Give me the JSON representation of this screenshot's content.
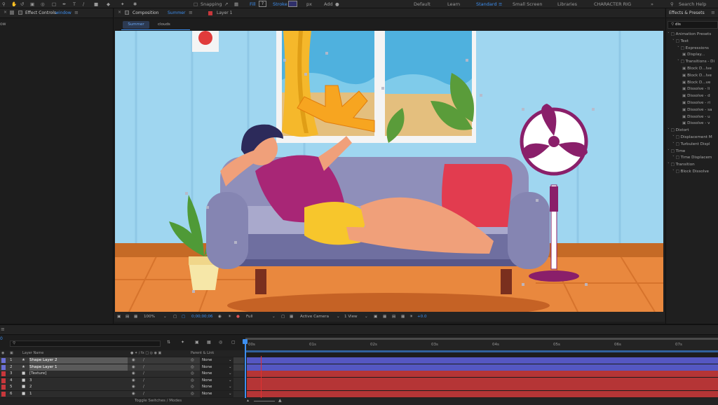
{
  "toolbar": {
    "snapping": "Snapping",
    "fill": "Fill",
    "stroke": "Stroke",
    "px": "px",
    "add": "Add"
  },
  "workspaces": [
    "Default",
    "Learn",
    "Standard",
    "Small Screen",
    "Libraries",
    "CHARACTER RIG"
  ],
  "active_workspace": "Standard",
  "search_help": "Search Help",
  "effect_controls": {
    "tab_label": "Effect Controls",
    "tab_target": "window",
    "side_text": "ow"
  },
  "composition": {
    "tab_label": "Composition",
    "tab_name": "Summer",
    "layer_tab": "Layer 1",
    "breadcrumb": [
      "Summer",
      "clouds"
    ]
  },
  "viewer": {
    "zoom": "100%",
    "timecode": "0;00;00;06",
    "resolution": "Full",
    "camera": "Active Camera",
    "views": "1 View",
    "exposure": "+0.0"
  },
  "effects": {
    "title": "Effects & Presets",
    "search": "dis",
    "items": [
      {
        "label": "Animation Presets",
        "level": 0
      },
      {
        "label": "Text",
        "level": 1
      },
      {
        "label": "Expressions",
        "level": 2
      },
      {
        "label": "Display...",
        "level": 3
      },
      {
        "label": "Transitions - Di",
        "level": 2
      },
      {
        "label": "Block D...lve",
        "level": 3
      },
      {
        "label": "Block D...lve",
        "level": 3
      },
      {
        "label": "Block D...ve",
        "level": 3
      },
      {
        "label": "Dissolve - li",
        "level": 3
      },
      {
        "label": "Dissolve - d",
        "level": 3
      },
      {
        "label": "Dissolve - ri",
        "level": 3
      },
      {
        "label": "Dissolve - sa",
        "level": 3
      },
      {
        "label": "Dissolve - u",
        "level": 3
      },
      {
        "label": "Dissolve - v",
        "level": 3
      },
      {
        "label": "Distort",
        "level": 0
      },
      {
        "label": "Displacement M",
        "level": 1
      },
      {
        "label": "Turbulent Displ",
        "level": 1
      },
      {
        "label": "Time",
        "level": 0
      },
      {
        "label": "Time Displacem",
        "level": 1
      },
      {
        "label": "Transition",
        "level": 0
      },
      {
        "label": "Block Dissolve",
        "level": 1
      }
    ]
  },
  "timeline": {
    "current_time": "0",
    "columns": {
      "layer_name": "Layer Name",
      "parent": "Parent & Link"
    },
    "layers": [
      {
        "num": "1",
        "name": "Shape Layer 2",
        "parent": "None",
        "color": "#6b6fd6",
        "track": "#5557c2"
      },
      {
        "num": "2",
        "name": "Shape Layer 1",
        "parent": "None",
        "color": "#6b6fd6",
        "track": "#5557c2"
      },
      {
        "num": "3",
        "name": "[Texture]",
        "parent": "None",
        "color": "#c8373b",
        "track": "#b53536"
      },
      {
        "num": "4",
        "name": "3",
        "parent": "None",
        "color": "#c8373b",
        "track": "#b53536"
      },
      {
        "num": "5",
        "name": "2",
        "parent": "None",
        "color": "#c8373b",
        "track": "#b53536"
      },
      {
        "num": "6",
        "name": "1",
        "parent": "None",
        "color": "#c8373b",
        "track": "#b53536"
      }
    ],
    "ticks": [
      "00s",
      "01s",
      "02s",
      "03s",
      "04s",
      "05s",
      "06s",
      "07s"
    ],
    "toggle": "Toggle Switches / Modes"
  },
  "colors": {
    "accent": "#3d8ff0",
    "wall": "#9fd6f0",
    "floor": "#e9883e",
    "sofa": "#8f8fba",
    "fan": "#8a1f6a"
  }
}
